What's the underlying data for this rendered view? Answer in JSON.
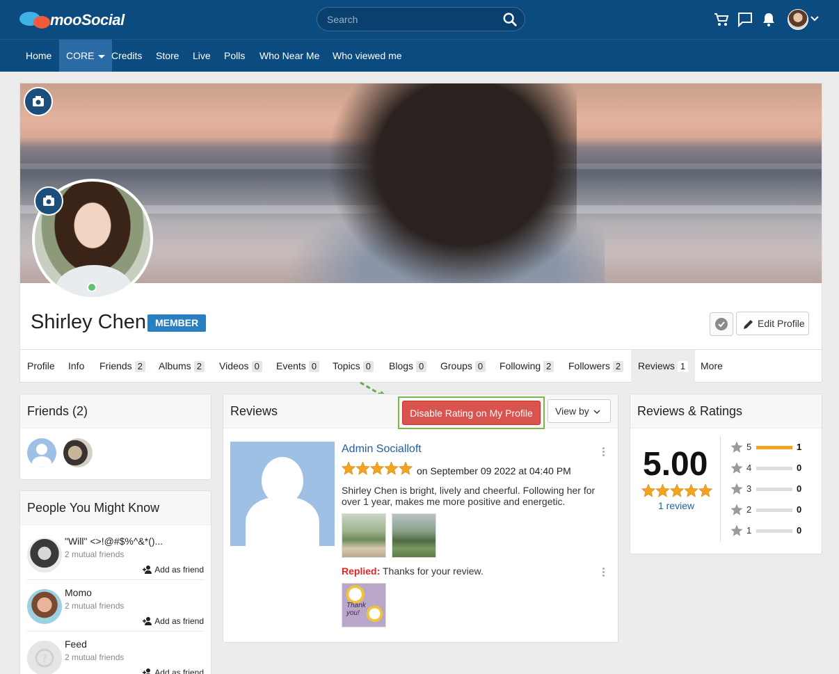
{
  "app": {
    "logo_text": "mooSocial",
    "search_placeholder": "Search"
  },
  "nav": {
    "items": [
      "Home",
      "CORE",
      "Credits",
      "Store",
      "Live",
      "Polls",
      "Who Near Me",
      "Who viewed me"
    ],
    "active": "CORE"
  },
  "profile": {
    "name": "Shirley Chen",
    "badge": "MEMBER",
    "edit_label": "Edit Profile",
    "tabs": [
      {
        "label": "Profile"
      },
      {
        "label": "Info"
      },
      {
        "label": "Friends",
        "count": "2"
      },
      {
        "label": "Albums",
        "count": "2"
      },
      {
        "label": "Videos",
        "count": "0"
      },
      {
        "label": "Events",
        "count": "0"
      },
      {
        "label": "Topics",
        "count": "0"
      },
      {
        "label": "Blogs",
        "count": "0"
      },
      {
        "label": "Groups",
        "count": "0"
      },
      {
        "label": "Following",
        "count": "2"
      },
      {
        "label": "Followers",
        "count": "2"
      },
      {
        "label": "Reviews",
        "count": "1"
      },
      {
        "label": "More"
      }
    ],
    "active_tab": "Reviews"
  },
  "friends_panel": {
    "title": "Friends (2)"
  },
  "pymk": {
    "title": "People You Might Know",
    "people": [
      {
        "name": "\"Will\" <>!@#$%^&*()...",
        "mutual": "2 mutual friends",
        "add": "Add as friend"
      },
      {
        "name": "Momo",
        "mutual": "2 mutual friends",
        "add": "Add as friend"
      },
      {
        "name": "Feed",
        "mutual": "2 mutual friends",
        "add": "Add as friend"
      }
    ]
  },
  "reviews": {
    "title": "Reviews",
    "disable_label": "Disable Rating on My Profile",
    "viewby_label": "View by",
    "item": {
      "author": "Admin Socialloft",
      "rating": 5,
      "date": "on September 09 2022 at 04:40 PM",
      "text": "Shirley Chen is bright, lively and cheerful. Following her for over 1 year, makes me more positive and energetic.",
      "replied_label": "Replied:",
      "reply_text": "Thanks for your review.",
      "reply_image_text": "Thank you!"
    }
  },
  "ratings": {
    "title": "Reviews & Ratings",
    "score": "5.00",
    "count_label": "1 review",
    "breakdown": [
      {
        "stars": "5",
        "count": "1",
        "fraction": 1
      },
      {
        "stars": "4",
        "count": "0",
        "fraction": 0
      },
      {
        "stars": "3",
        "count": "0",
        "fraction": 0
      },
      {
        "stars": "2",
        "count": "0",
        "fraction": 0
      },
      {
        "stars": "1",
        "count": "0",
        "fraction": 0
      }
    ]
  },
  "colors": {
    "header": "#0c4b80",
    "danger": "#d9534f",
    "star": "#f3a320",
    "link": "#1f5fa0",
    "highlight": "#7ab648"
  }
}
